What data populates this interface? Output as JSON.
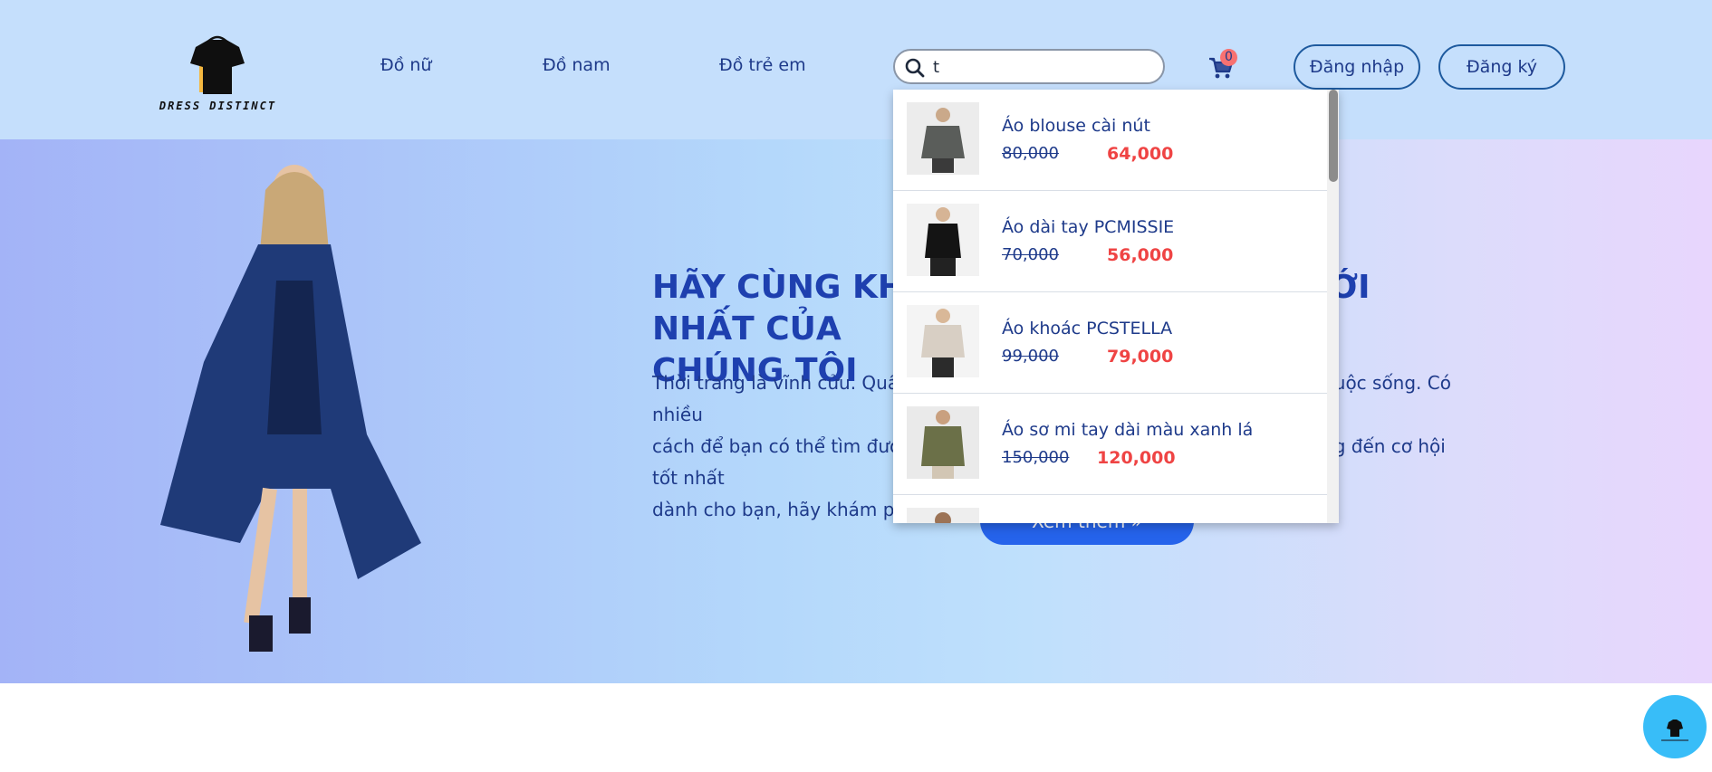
{
  "header": {
    "logo_text": "DRESS DISTINCT",
    "nav": [
      "Đồ nữ",
      "Đồ nam",
      "Đồ trẻ em"
    ],
    "search_value": "t",
    "cart_count": "0",
    "login_label": "Đăng nhập",
    "register_label": "Đăng ký"
  },
  "hero": {
    "title_line1": "HÃY CÙNG KHÁM PHÁ BỘ SƯU TẬP MỚI NHẤT CỦA",
    "title_line2": "CHÚNG TÔI",
    "desc_line1": "Thời trang là vĩnh cửu. Quần áo đẹp sẽ khiến bạn trở nên tự tin hơn trong cuộc sống. Có nhiều",
    "desc_line2": "cách để bạn có thể tìm được bộ trang phục phù hợp, tại đây chúng tôi mang đến cơ hội tốt nhất",
    "desc_line3": "dành cho bạn, hãy khám phá ngay!",
    "button_label": "Xem thêm »"
  },
  "dropdown": {
    "items": [
      {
        "name": "Áo blouse cài nút",
        "old_price": "80,000",
        "new_price": "64,000"
      },
      {
        "name": "Áo dài tay PCMISSIE",
        "old_price": "70,000",
        "new_price": "56,000"
      },
      {
        "name": "Áo khoác PCSTELLA",
        "old_price": "99,000",
        "new_price": "79,000"
      },
      {
        "name": "Áo sơ mi tay dài màu xanh lá",
        "old_price": "150,000",
        "new_price": "120,000"
      }
    ]
  },
  "icons": {
    "search": "search-icon",
    "cart": "cart-icon",
    "logo": "shirt-bag-logo",
    "chat": "chat-bubble-icon"
  },
  "colors": {
    "header_bg": "#c5dffc",
    "accent": "#2563eb",
    "title": "#1e40af",
    "sale_price": "#ef4444",
    "badge": "#f87171"
  }
}
